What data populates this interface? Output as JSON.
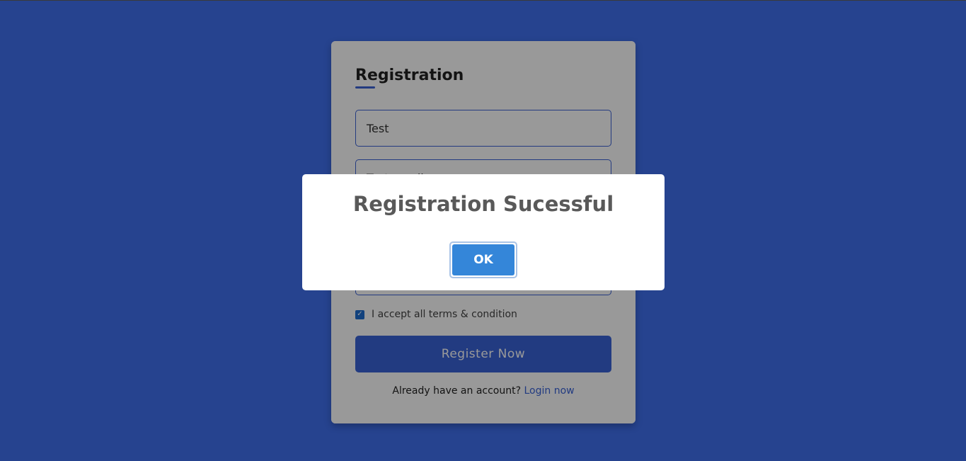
{
  "colors": {
    "background": "#26438f",
    "accent": "#3a63d8",
    "ok_button": "#3486d9"
  },
  "form": {
    "title": "Registration",
    "fields": [
      {
        "value": "Test"
      },
      {
        "value": "Test email"
      },
      {
        "value": ""
      },
      {
        "value": ""
      }
    ],
    "terms_label": "I accept all terms & condition",
    "terms_checked": true,
    "register_label": "Register Now",
    "login_prompt": "Already have an account?",
    "login_link": "Login now"
  },
  "modal": {
    "title": "Registration Sucessful",
    "ok_label": "OK"
  }
}
